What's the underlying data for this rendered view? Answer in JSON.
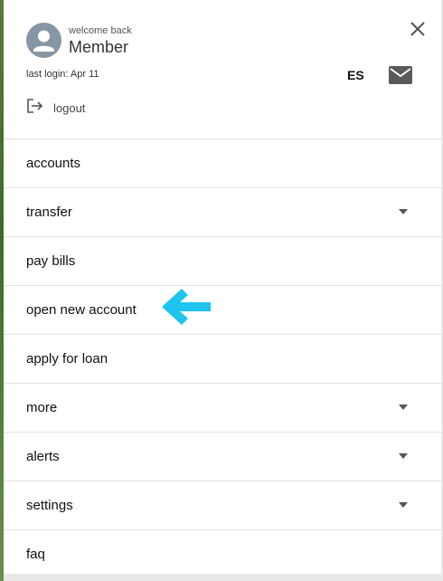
{
  "header": {
    "welcome": "welcome back",
    "member": "Member",
    "last_login": "last login: Apr 11",
    "language": "ES",
    "logout_label": "logout"
  },
  "menu": [
    {
      "label": "accounts",
      "expandable": false
    },
    {
      "label": "transfer",
      "expandable": true
    },
    {
      "label": "pay bills",
      "expandable": false
    },
    {
      "label": "open new account",
      "expandable": false
    },
    {
      "label": "apply for loan",
      "expandable": false
    },
    {
      "label": "more",
      "expandable": true
    },
    {
      "label": "alerts",
      "expandable": true
    },
    {
      "label": "settings",
      "expandable": true
    },
    {
      "label": "faq",
      "expandable": false
    }
  ],
  "colors": {
    "avatar_bg": "#8696a4",
    "accent_arrow": "#1ec5ee",
    "mail_icon": "#5a5a5a"
  },
  "icons": [
    "user-avatar-icon",
    "close-icon",
    "mail-icon",
    "logout-icon",
    "chevron-down-icon",
    "pointer-arrow-icon"
  ]
}
